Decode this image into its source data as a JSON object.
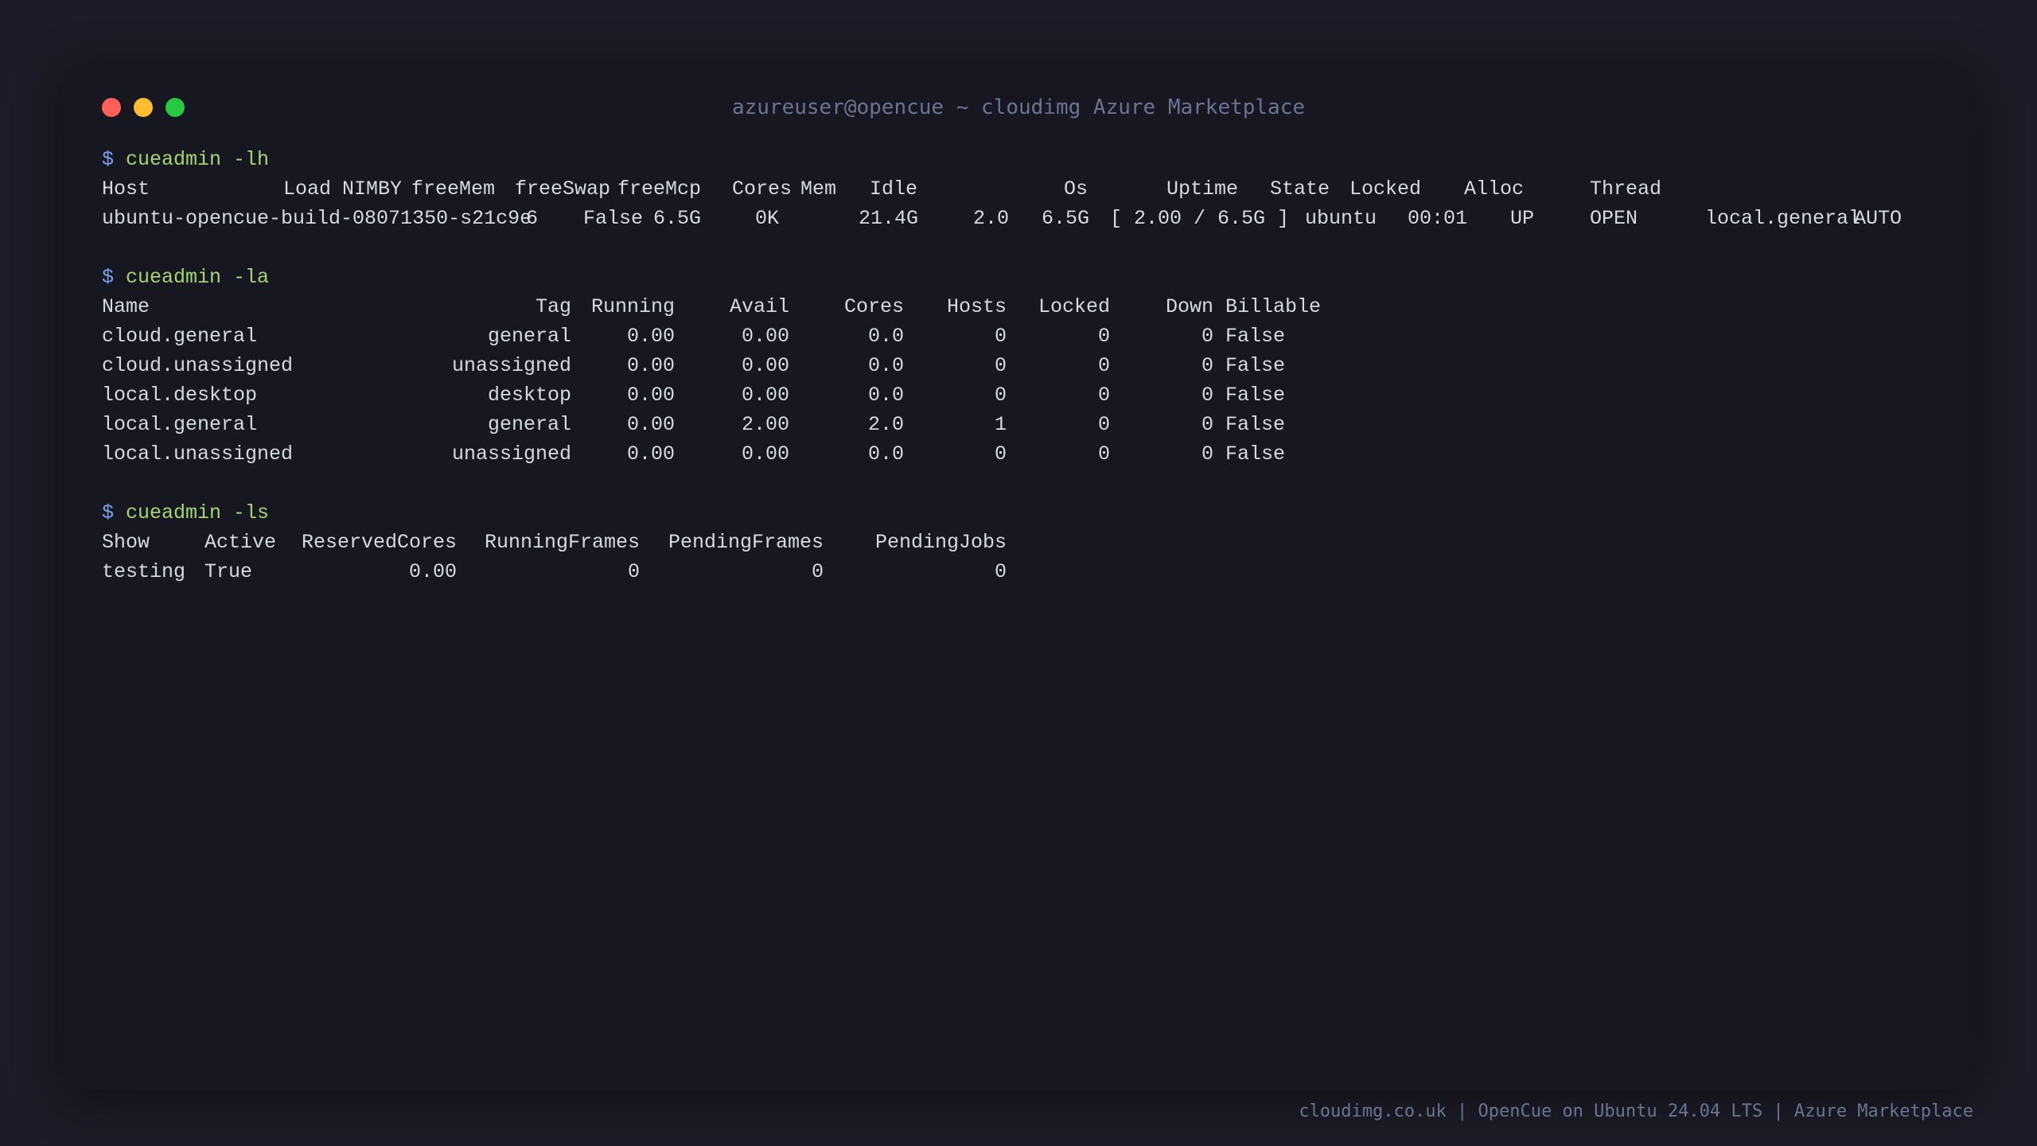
{
  "window": {
    "title": "azureuser@opencue ~ cloudimg Azure Marketplace"
  },
  "prompt_symbol": "$",
  "lh": {
    "command": "cueadmin -lh",
    "headers": [
      "Host",
      "Load",
      "NIMBY",
      "freeMem",
      "freeSwap",
      "freeMcp",
      "Cores",
      "Mem",
      "Idle",
      "Os",
      "Uptime",
      "State",
      "Locked",
      "Alloc",
      "Thread"
    ],
    "row": [
      "ubuntu-opencue-build-08071350-s21c9e",
      "6",
      "False",
      "6.5G",
      "0K",
      "21.4G",
      "2.0",
      "6.5G",
      "[ 2.00 / 6.5G ]",
      "ubuntu",
      "00:01",
      "UP",
      "OPEN",
      "local.general",
      "AUTO"
    ]
  },
  "la": {
    "command": "cueadmin -la",
    "headers": [
      "Name",
      "Tag",
      "Running",
      "Avail",
      "Cores",
      "Hosts",
      "Locked",
      "Down",
      "Billable"
    ],
    "rows": [
      [
        "cloud.general",
        "general",
        "0.00",
        "0.00",
        "0.0",
        "0",
        "0",
        "0",
        "False"
      ],
      [
        "cloud.unassigned",
        "unassigned",
        "0.00",
        "0.00",
        "0.0",
        "0",
        "0",
        "0",
        "False"
      ],
      [
        "local.desktop",
        "desktop",
        "0.00",
        "0.00",
        "0.0",
        "0",
        "0",
        "0",
        "False"
      ],
      [
        "local.general",
        "general",
        "0.00",
        "2.00",
        "2.0",
        "1",
        "0",
        "0",
        "False"
      ],
      [
        "local.unassigned",
        "unassigned",
        "0.00",
        "0.00",
        "0.0",
        "0",
        "0",
        "0",
        "False"
      ]
    ]
  },
  "ls": {
    "command": "cueadmin -ls",
    "headers": [
      "Show",
      "Active",
      "ReservedCores",
      "RunningFrames",
      "PendingFrames",
      "PendingJobs"
    ],
    "rows": [
      [
        "testing",
        "True",
        "0.00",
        "0",
        "0",
        "0"
      ]
    ]
  },
  "footer": "cloudimg.co.uk | OpenCue on Ubuntu 24.04 LTS | Azure Marketplace",
  "colors": {
    "background": "#1b1c27",
    "window": "#161720",
    "text": "#d6d8e2",
    "command": "#a6d66f",
    "prompt": "#7aa2f7",
    "muted": "#6d7390",
    "close": "#ff5f57",
    "minimize": "#febc2e",
    "maximize": "#28c840"
  }
}
